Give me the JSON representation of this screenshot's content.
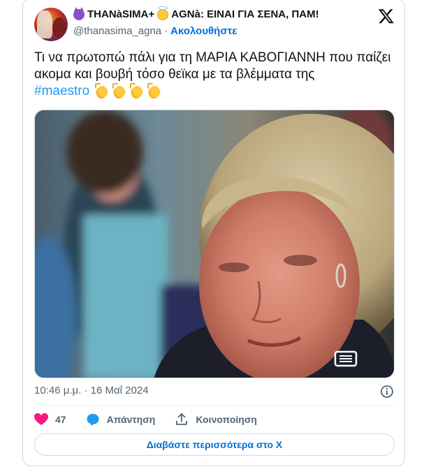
{
  "author": {
    "display_name_part1": "THANàSIMA+",
    "display_name_part2": "AGNà: ΕΙΝΑΙ ΓΙΑ ΣΕΝΑ, ΠΑΜ!",
    "name_emoji_1": "smiling-imp-icon",
    "name_emoji_2": "smiling-face-with-halo-icon",
    "handle": "@thanasima_agna",
    "separator": "·",
    "follow_label": "Ακολουθήστε"
  },
  "platform_logo": "x-logo-icon",
  "tweet": {
    "text_line": "Τι να πρωτοπώ πάλι για τη ΜΑΡΙΑ ΚΑΒΟΓΙΑΝΝΗ που παίζει ακομα και βουβή τόσο θεϊκα με τα βλέμματα της",
    "hashtag": "#maestro",
    "trailing_emoji": [
      "clapping-hands-icon",
      "clapping-hands-icon",
      "clapping-hands-icon",
      "clapping-hands-icon"
    ]
  },
  "timestamp": "10:46 μ.μ. · 16 Μαΐ 2024",
  "actions": {
    "like_count": "47",
    "reply_label": "Απάντηση",
    "share_label": "Κοινοποίηση"
  },
  "read_more_label": "Διαβάστε περισσότερα στο X",
  "colors": {
    "accent_link": "#1d9bf0",
    "follow_link": "#006fd6",
    "like_heart": "#f91880",
    "muted_text": "#536471",
    "border": "#cfd9de"
  }
}
